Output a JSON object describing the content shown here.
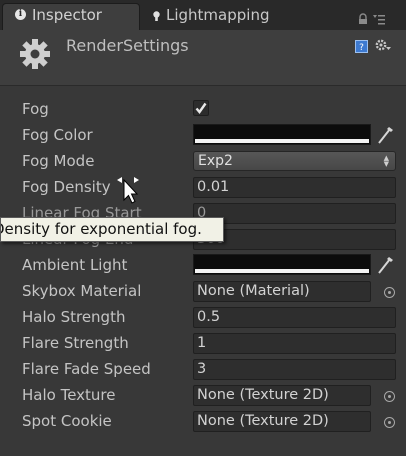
{
  "tabs": {
    "inspector": "Inspector",
    "lightmapping": "Lightmapping"
  },
  "header": {
    "title": "RenderSettings"
  },
  "properties": {
    "fog": {
      "label": "Fog",
      "checked": true
    },
    "fog_color": {
      "label": "Fog Color"
    },
    "fog_mode": {
      "label": "Fog Mode",
      "value": "Exp2"
    },
    "fog_density": {
      "label": "Fog Density",
      "value": "0.01"
    },
    "linear_fog_start": {
      "label": "Linear Fog Start",
      "value": "0"
    },
    "linear_fog_end": {
      "label": "Linear Fog End",
      "value": "300"
    },
    "ambient_light": {
      "label": "Ambient Light"
    },
    "skybox_material": {
      "label": "Skybox Material",
      "value": "None (Material)"
    },
    "halo_strength": {
      "label": "Halo Strength",
      "value": "0.5"
    },
    "flare_strength": {
      "label": "Flare Strength",
      "value": "1"
    },
    "flare_fade_speed": {
      "label": "Flare Fade Speed",
      "value": "3"
    },
    "halo_texture": {
      "label": "Halo Texture",
      "value": "None (Texture 2D)"
    },
    "spot_cookie": {
      "label": "Spot Cookie",
      "value": "None (Texture 2D)"
    }
  },
  "tooltip": {
    "text": "Density for exponential fog."
  },
  "colors": {
    "panel_bg": "#383838",
    "field_bg": "#2e2e2e",
    "tooltip_bg": "#f1f1e6"
  }
}
